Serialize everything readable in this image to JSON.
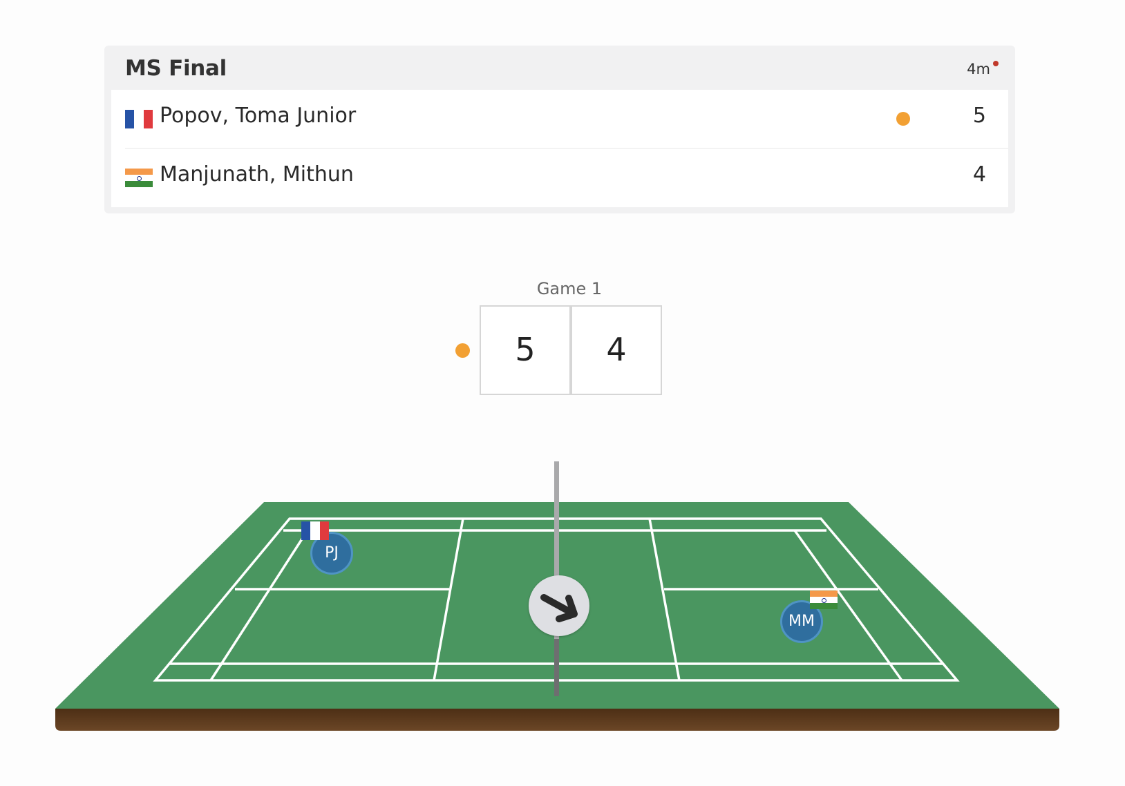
{
  "match": {
    "title": "MS Final",
    "duration": "4m"
  },
  "players": [
    {
      "name": "Popov, Toma Junior",
      "country_flag": "flag-france-icon",
      "score": "5",
      "serving": true,
      "initials": "PJ"
    },
    {
      "name": "Manjunath, Mithun",
      "country_flag": "flag-india-icon",
      "score": "4",
      "serving": false,
      "initials": "MM"
    }
  ],
  "game": {
    "label": "Game 1",
    "score_left": "5",
    "score_right": "4"
  },
  "colors": {
    "court_green": "#4a9660",
    "court_base": "#5b3a1d",
    "serve_indicator": "#f2a033",
    "player_marker": "#2f6e9e",
    "live_indicator": "#c0392b"
  },
  "icons": {
    "live": "live-dot-icon",
    "serve": "shuttlecock-serve-icon",
    "direction": "arrow-down-right-icon"
  }
}
